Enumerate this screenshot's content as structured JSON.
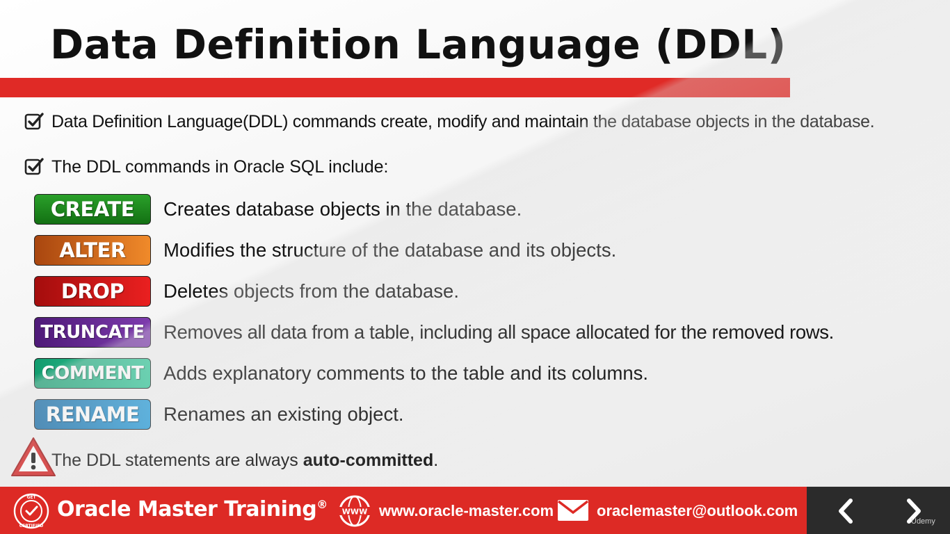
{
  "slide": {
    "title": "Data  Definition  Language (DDL)",
    "bullets": [
      "Data Definition Language(DDL) commands create, modify and maintain the database objects in the database.",
      "The DDL commands in Oracle SQL include:"
    ],
    "commands": [
      {
        "name": "CREATE",
        "description": "Creates database objects in the database.",
        "color": "#1f8a1f"
      },
      {
        "name": "ALTER",
        "description": "Modifies the structure of the database and its objects.",
        "color": "#e0721a"
      },
      {
        "name": "DROP",
        "description": "Deletes objects from the database.",
        "color": "#d01818"
      },
      {
        "name": "TRUNCATE",
        "description": "Removes all data from a table, including all space allocated for the removed rows.",
        "color": "#6a2a96"
      },
      {
        "name": "COMMENT",
        "description": "Adds explanatory comments to the table and its columns.",
        "color": "#22b489"
      },
      {
        "name": "RENAME",
        "description": "Renames an existing object.",
        "color": "#1e88c8"
      }
    ],
    "note": {
      "prefix": "The DDL statements are always ",
      "bold": "auto-committed",
      "suffix": "."
    }
  },
  "footer": {
    "brand": "Oracle Master Training",
    "registered": "®",
    "logo_text_top": "GET",
    "logo_text_bottom": "CERTIFIED",
    "www_icon_label": "WWW",
    "website": "www.oracle-master.com",
    "email": "oraclemaster@outlook.com",
    "watermark": "Udemy"
  },
  "colors": {
    "accent_red": "#dd2a25",
    "nav_bg": "#2b2b2b"
  },
  "icons": [
    "checkbox-icon",
    "warning-icon",
    "certified-logo-icon",
    "www-globe-icon",
    "mail-icon",
    "chevron-left-icon",
    "chevron-right-icon"
  ]
}
